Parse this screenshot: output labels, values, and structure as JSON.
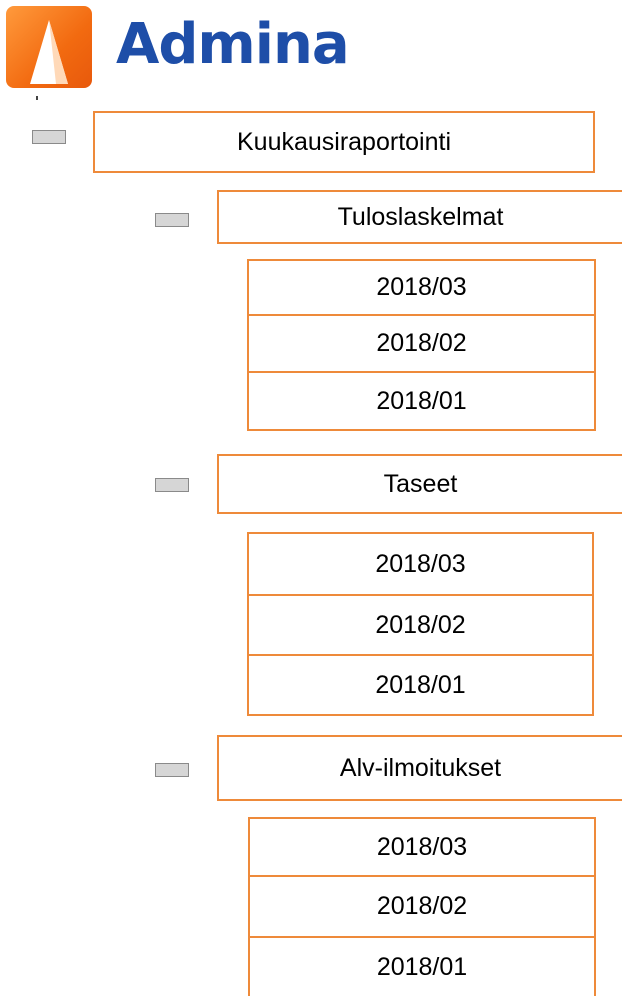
{
  "logo": {
    "text": "Admina"
  },
  "menu": {
    "root": {
      "label": "Kuukausiraportointi"
    },
    "sections": [
      {
        "label": "Tuloslaskelmat",
        "items": [
          "2018/03",
          "2018/02",
          "2018/01"
        ]
      },
      {
        "label": "Taseet",
        "items": [
          "2018/03",
          "2018/02",
          "2018/01"
        ]
      },
      {
        "label": "Alv-ilmoitukset",
        "items": [
          "2018/03",
          "2018/02",
          "2018/01"
        ]
      }
    ]
  },
  "colors": {
    "accent_border": "#ee8a3a",
    "logo_orange": "#f26a10",
    "logo_blue": "#1e4ea8",
    "toggle_fill": "#d6d6d6"
  },
  "icons": {
    "logo_mark": "admina-logo-icon",
    "toggle": "collapse-toggle-icon"
  }
}
